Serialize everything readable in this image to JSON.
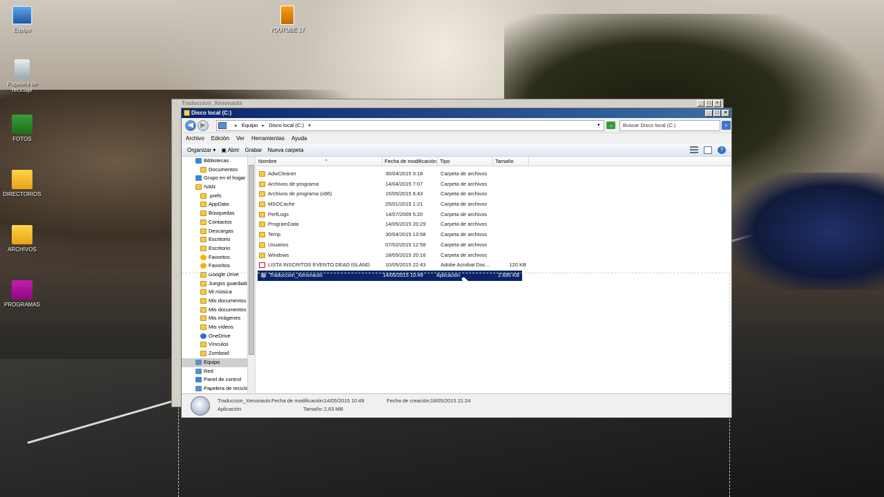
{
  "desktop": {
    "icons": [
      {
        "label": "Equipo",
        "icon": "computer-icon"
      },
      {
        "label": "YOUTUBE 17",
        "icon": "video-file-icon"
      },
      {
        "label": "Papelera de reciclaje",
        "icon": "recycle-bin-icon"
      },
      {
        "label": "FOTOS",
        "icon": "photos-shortcut-icon"
      },
      {
        "label": "DIRECTORIOS",
        "icon": "folder-shortcut-icon"
      },
      {
        "label": "ARCHIVOS",
        "icon": "folder-shortcut-icon"
      },
      {
        "label": "PROGRAMAS",
        "icon": "programs-shortcut-icon"
      }
    ]
  },
  "back_window": {
    "title": "Traduccion_Xenonauts"
  },
  "window": {
    "title": "Disco local (C:)",
    "address": {
      "root": "Equipo",
      "current": "Disco local (C:)"
    },
    "search_placeholder": "Buscar Disco local (C:)",
    "menu": [
      "Archivo",
      "Edición",
      "Ver",
      "Herramientas",
      "Ayuda"
    ],
    "toolbar": {
      "organize": "Organizar",
      "open": "Abrir",
      "burn": "Grabar",
      "new_folder": "Nueva carpeta"
    },
    "nav": [
      {
        "label": "Bibliotecas",
        "icon": "library-icon",
        "indent": 1
      },
      {
        "label": "Documentos",
        "icon": "folder-icon",
        "indent": 2
      },
      {
        "label": "Grupo en el hogar",
        "icon": "homegroup-icon",
        "indent": 1
      },
      {
        "label": "IVAN",
        "icon": "user-icon",
        "indent": 1
      },
      {
        "label": ".prefs",
        "icon": "folder-icon",
        "indent": 2
      },
      {
        "label": "AppData",
        "icon": "folder-icon",
        "indent": 2
      },
      {
        "label": "Búsquedas",
        "icon": "folder-icon",
        "indent": 2
      },
      {
        "label": "Contactos",
        "icon": "folder-icon",
        "indent": 2
      },
      {
        "label": "Descargas",
        "icon": "folder-icon",
        "indent": 2
      },
      {
        "label": "Escritorio",
        "icon": "folder-icon",
        "indent": 2
      },
      {
        "label": "Escritorio",
        "icon": "folder-icon",
        "indent": 2
      },
      {
        "label": "Favoritos",
        "icon": "star-icon",
        "indent": 2
      },
      {
        "label": "Favoritos",
        "icon": "star-icon",
        "indent": 2
      },
      {
        "label": "Google Drive",
        "icon": "folder-icon",
        "indent": 2
      },
      {
        "label": "Juegos guardados",
        "icon": "folder-icon",
        "indent": 2
      },
      {
        "label": "Mi música",
        "icon": "folder-icon",
        "indent": 2
      },
      {
        "label": "Mis documentos",
        "icon": "folder-icon",
        "indent": 2
      },
      {
        "label": "Mis documentos",
        "icon": "folder-icon",
        "indent": 2
      },
      {
        "label": "Mis imágenes",
        "icon": "folder-icon",
        "indent": 2
      },
      {
        "label": "Mis vídeos",
        "icon": "folder-icon",
        "indent": 2
      },
      {
        "label": "OneDrive",
        "icon": "cloud-icon",
        "indent": 2
      },
      {
        "label": "Vínculos",
        "icon": "folder-icon",
        "indent": 2
      },
      {
        "label": "Zomboid",
        "icon": "folder-icon",
        "indent": 2
      },
      {
        "label": "Equipo",
        "icon": "computer-icon",
        "indent": 1,
        "selected": true
      },
      {
        "label": "Red",
        "icon": "network-icon",
        "indent": 1
      },
      {
        "label": "Panel de control",
        "icon": "control-panel-icon",
        "indent": 1
      },
      {
        "label": "Papelera de reciclaje",
        "icon": "recycle-bin-icon",
        "indent": 1
      }
    ],
    "columns": {
      "name": "Nombre",
      "date": "Fecha de modificación",
      "type": "Tipo",
      "size": "Tamaño"
    },
    "files": [
      {
        "name": "AdwCleaner",
        "date": "30/04/2015 0:18",
        "type": "Carpeta de archivos",
        "size": "",
        "kind": "folder"
      },
      {
        "name": "Archivos de programa",
        "date": "14/04/2015 7:07",
        "type": "Carpeta de archivos",
        "size": "",
        "kind": "folder"
      },
      {
        "name": "Archivos de programa (x86)",
        "date": "15/05/2015 6:43",
        "type": "Carpeta de archivos",
        "size": "",
        "kind": "folder"
      },
      {
        "name": "MSOCache",
        "date": "25/01/2015 1:21",
        "type": "Carpeta de archivos",
        "size": "",
        "kind": "folder"
      },
      {
        "name": "PerfLogs",
        "date": "14/07/2009 5:20",
        "type": "Carpeta de archivos",
        "size": "",
        "kind": "folder"
      },
      {
        "name": "ProgramData",
        "date": "14/05/2015 20:29",
        "type": "Carpeta de archivos",
        "size": "",
        "kind": "folder"
      },
      {
        "name": "Temp",
        "date": "30/04/2015 13:58",
        "type": "Carpeta de archivos",
        "size": "",
        "kind": "folder"
      },
      {
        "name": "Usuarios",
        "date": "07/02/2015 12:58",
        "type": "Carpeta de archivos",
        "size": "",
        "kind": "folder"
      },
      {
        "name": "Windows",
        "date": "18/05/2015 20:16",
        "type": "Carpeta de archivos",
        "size": "",
        "kind": "folder"
      },
      {
        "name": "LISTA INSCRITOS EVENTO DEAD ISLAND",
        "date": "10/05/2015 22:43",
        "type": "Adobe Acrobat Doc...",
        "size": "120 KB",
        "kind": "pdf"
      },
      {
        "name": "Traduccion_Xenonauts",
        "date": "14/05/2015 10:49",
        "type": "Aplicación",
        "size": "2.695 KB",
        "kind": "app",
        "selected": true
      }
    ],
    "details": {
      "name": "Traduccion_Xenonauts",
      "kind": "Aplicación",
      "modified_label": "Fecha de modificación:",
      "modified": "14/05/2015 10:49",
      "size_label": "Tamaño:",
      "size": "2,63 MB",
      "created_label": "Fecha de creación:",
      "created": "18/05/2015 21:24"
    }
  }
}
